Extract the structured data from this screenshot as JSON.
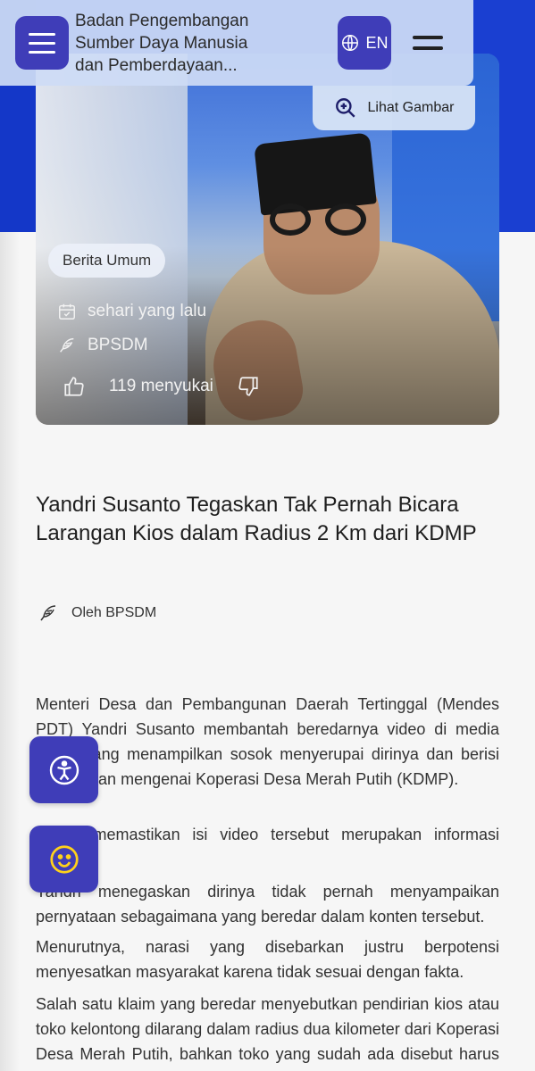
{
  "header": {
    "site_title": "Badan Pengembangan Sumber Daya Manusia dan Pemberdayaan...",
    "lang_label": "EN",
    "view_image_label": "Lihat Gambar"
  },
  "hero": {
    "category_badge": "Berita Umum",
    "date": "sehari yang lalu",
    "author": "BPSDM",
    "likes": "119 menyukai"
  },
  "article": {
    "title": "Yandri Susanto Tegaskan Tak Pernah Bicara Larangan Kios dalam Radius 2 Km dari KDMP",
    "byline": "Oleh BPSDM",
    "paragraphs": [
      "Menteri Desa dan Pembangunan Daerah Tertinggal (Mendes PDT) Yandri Susanto membantah beredarnya video di media sosial yang menampilkan sosok menyerupai dirinya dan berisi pernyataan mengenai Koperasi Desa Merah Putih (KDMP).",
      "Yandri memastikan isi video tersebut merupakan informasi hoaks.",
      "Yandri menegaskan dirinya tidak pernah menyampaikan pernyataan sebagaimana yang beredar dalam konten tersebut.",
      "Menurutnya, narasi yang disebarkan justru berpotensi menyesatkan masyarakat karena tidak sesuai dengan fakta.",
      "Salah satu klaim yang beredar menyebutkan pendirian kios atau toko kelontong dilarang dalam radius dua kilometer dari Koperasi Desa Merah Putih, bahkan toko yang sudah ada disebut harus dibuka kembali."
    ]
  },
  "colors": {
    "brand_purple": "#3f3db8",
    "brand_blue": "#1a3fd1",
    "header_bg": "#cddcf5"
  },
  "icons": {
    "menu": "hamburger-icon",
    "lang": "globe-icon",
    "more": "two-line-menu-icon",
    "view": "zoom-in-icon",
    "date": "calendar-check-icon",
    "author": "feather-pen-icon",
    "like": "thumbs-up-icon",
    "dislike": "thumbs-down-icon",
    "accessibility": "accessibility-icon",
    "emoji": "smiley-icon"
  }
}
